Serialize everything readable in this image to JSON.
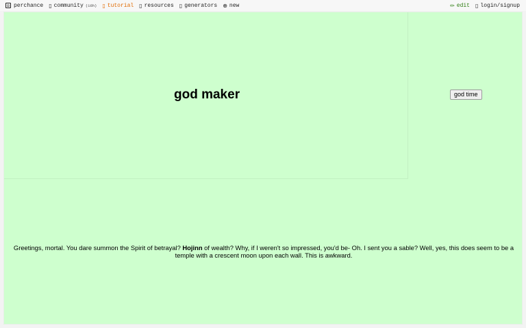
{
  "nav": {
    "left": [
      {
        "icon": "dice-icon",
        "label": "perchance"
      },
      {
        "icon": "community-icon",
        "label": "community",
        "badge": "(16h)"
      },
      {
        "icon": "tutorial-icon",
        "label": "tutorial"
      },
      {
        "icon": "resources-icon",
        "label": "resources"
      },
      {
        "icon": "generators-icon",
        "label": "generators"
      },
      {
        "icon": "plus-circle-icon",
        "label": "new"
      }
    ],
    "right": [
      {
        "icon": "pencil-icon",
        "label": "edit"
      },
      {
        "icon": "user-icon",
        "label": "login/signup"
      }
    ]
  },
  "generator": {
    "title": "god maker",
    "button_label": "god time"
  },
  "output": {
    "before": "Greetings, mortal. You dare summon the Spirit of betrayal? ",
    "name": "Hojinn",
    "after": " of wealth? Why, if I weren't so impressed, you'd be- Oh. I sent you a sable? Well, yes, this does seem to be a temple with a crescent moon upon each wall. This is awkward."
  },
  "colors": {
    "panel_bg": "#ceffce",
    "tutorial_accent": "#e06a00",
    "edit_accent": "#2e7d12"
  }
}
